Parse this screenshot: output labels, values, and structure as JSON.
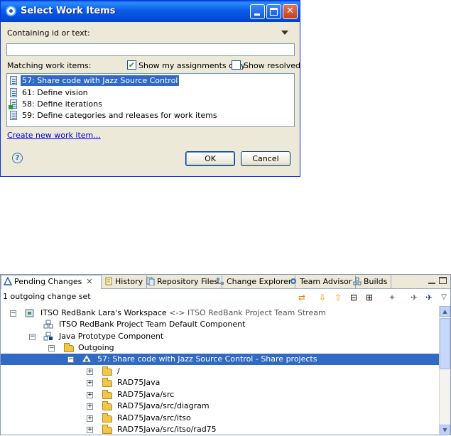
{
  "dialog": {
    "title": "Select Work Items",
    "containing_label": "Containing id or text:",
    "search_value": "",
    "matching_label": "Matching work items:",
    "show_my_assignments_label": "Show my assignments only",
    "show_my_assignments_checked": true,
    "show_resolved_label": "Show resolved",
    "show_resolved_checked": false,
    "items": [
      {
        "label": "57: Share code with Jazz Source Control",
        "selected": true
      },
      {
        "label": "61: Define vision",
        "selected": false
      },
      {
        "label": "58: Define iterations",
        "selected": false
      },
      {
        "label": "59: Define categories and releases for work items",
        "selected": false
      }
    ],
    "create_link": "Create new work item...",
    "help_glyph": "?",
    "ok_label": "OK",
    "cancel_label": "Cancel"
  },
  "view": {
    "tabs": [
      {
        "label": "Pending Changes",
        "icon": "triangle-delta-icon",
        "active": true
      },
      {
        "label": "History",
        "icon": "history-icon"
      },
      {
        "label": "Repository Files",
        "icon": "files-icon"
      },
      {
        "label": "Change Explorer",
        "icon": "change-explorer-icon"
      },
      {
        "label": "Team Advisor",
        "icon": "gear-icon"
      },
      {
        "label": "Builds",
        "icon": "builds-icon"
      }
    ],
    "status": "1 outgoing change set",
    "tree": {
      "workspace": "ITSO RedBank Lara's Workspace",
      "workspace_flow": "<-> ITSO RedBank Project Team Stream",
      "default_component": "ITSO RedBank Project Team Default Component",
      "component": "Java Prototype Component",
      "outgoing": "Outgoing",
      "change_set": "57: Share code with Jazz Source Control - Share projects",
      "folders": [
        "/",
        "RAD75Java",
        "RAD75Java/src",
        "RAD75Java/src/diagram",
        "RAD75Java/src/itso",
        "RAD75Java/src/itso/rad75"
      ]
    }
  },
  "colors": {
    "selection": "#316ac5",
    "titlebar": "#0a5bea",
    "dialog_bg": "#ece9d8"
  }
}
